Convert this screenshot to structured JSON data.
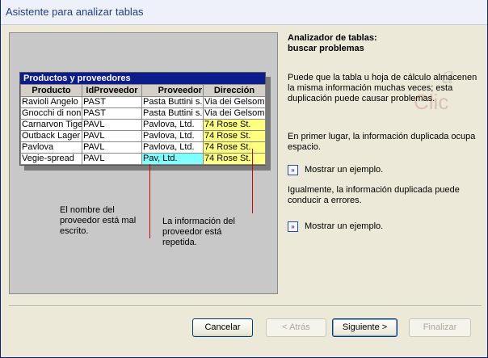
{
  "window": {
    "title": "Asistente para analizar tablas"
  },
  "example_table": {
    "title": "Productos y proveedores",
    "columns": [
      "Producto",
      "IdProveedor",
      "Proveedor",
      "Dirección"
    ],
    "rows": [
      [
        "Ravioli Angelo",
        "PAST",
        "Pasta Buttini s.r.l.",
        "Via dei Gelsomini"
      ],
      [
        "Gnocchi di nonna",
        "PAST",
        "Pasta Buttini s.r.l.",
        "Via dei Gelsomini"
      ],
      [
        "Carnarvon Tigers",
        "PAVL",
        "Pavlova, Ltd.",
        "74 Rose St."
      ],
      [
        "Outback Lager",
        "PAVL",
        "Pavlova, Ltd.",
        "74 Rose St."
      ],
      [
        "Pavlova",
        "PAVL",
        "Pavlova, Ltd.",
        "74 Rose St."
      ],
      [
        "Vegie-spread",
        "PAVL",
        "Pav, Ltd.",
        "74 Rose St."
      ]
    ]
  },
  "callouts": {
    "misspelled": [
      "El nombre del",
      "proveedor está mal",
      "escrito."
    ],
    "repeated": [
      "La información del",
      "proveedor está",
      "repetida."
    ]
  },
  "right": {
    "title_line1": "Analizador de tablas:",
    "title_line2": "buscar problemas",
    "para1": "Puede que la tabla u hoja de cálculo almacenen la misma información muchas veces; esta duplicación puede causar problemas.",
    "para2": "En primer lugar, la información duplicada ocupa espacio.",
    "link1": "Mostrar un ejemplo.",
    "para3": "Igualmente, la información duplicada puede conducir a errores.",
    "link2": "Mostrar un ejemplo."
  },
  "watermark": {
    "text1": "a",
    "text2": "Clic"
  },
  "buttons": {
    "cancel": "Cancelar",
    "back": "< Atrás",
    "next": "Siguiente >",
    "finish": "Finalizar"
  },
  "colors": {
    "title_text": "#1b3f8c",
    "grid_title": "#0c1c8c",
    "highlight_yellow": "#ffff80",
    "highlight_cyan": "#80ffff",
    "callout_line": "#d00000"
  }
}
